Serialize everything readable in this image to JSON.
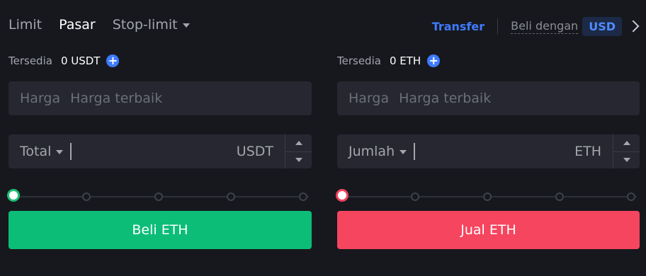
{
  "tabs": [
    {
      "label": "Limit"
    },
    {
      "label": "Pasar"
    },
    {
      "label": "Stop-limit"
    }
  ],
  "header": {
    "transfer": "Transfer",
    "buy_with": "Beli dengan",
    "currency": "USD"
  },
  "buy_panel": {
    "available_label": "Tersedia",
    "available_value": "0 USDT",
    "price_label": "Harga",
    "price_value": "Harga terbaik",
    "amount_selector": "Total",
    "amount_unit": "USDT",
    "slider_value_percent": 0,
    "action_label": "Beli ETH"
  },
  "sell_panel": {
    "available_label": "Tersedia",
    "available_value": "0 ETH",
    "price_label": "Harga",
    "price_value": "Harga terbaik",
    "amount_selector": "Jumlah",
    "amount_unit": "ETH",
    "slider_value_percent": 0,
    "action_label": "Jual ETH"
  },
  "colors": {
    "accent": "#3e7bff",
    "buy": "#0bbd77",
    "sell": "#f6455f"
  }
}
